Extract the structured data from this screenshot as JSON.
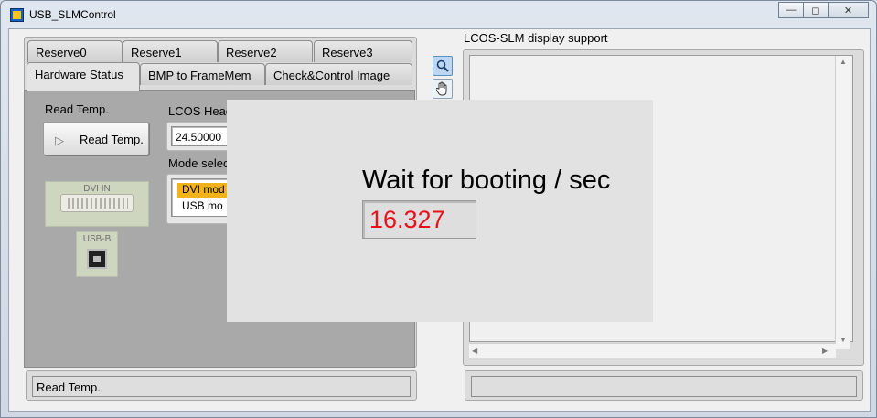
{
  "window": {
    "title": "USB_SLMControl",
    "buttons": {
      "minimize": "—",
      "restore": "◻",
      "close": "✕"
    }
  },
  "tabs": {
    "row1": [
      "Reserve0",
      "Reserve1",
      "Reserve2",
      "Reserve3"
    ],
    "row2": [
      "Hardware Status",
      "BMP to FrameMem",
      "Check&Control Image"
    ],
    "active": "Hardware Status"
  },
  "hardware": {
    "read_temp_label": "Read Temp.",
    "read_temp_button": "Read Temp.",
    "lcos_head_label": "LCOS Head",
    "lcos_head_value": "24.50000",
    "mode_label": "Mode selec",
    "modes": [
      "DVI mod",
      "USB mo"
    ],
    "selected_mode": "DVI mod",
    "dvi_label": "DVI IN",
    "usb_label": "USB-B"
  },
  "status_left": "Read Temp.",
  "status_right": "",
  "display": {
    "label": "LCOS-SLM display support",
    "tools": [
      "zoom-icon",
      "hand-icon"
    ]
  },
  "boot_overlay": {
    "title": "Wait for booting / sec",
    "seconds": "16.327",
    "value_color": "#e8111c"
  }
}
